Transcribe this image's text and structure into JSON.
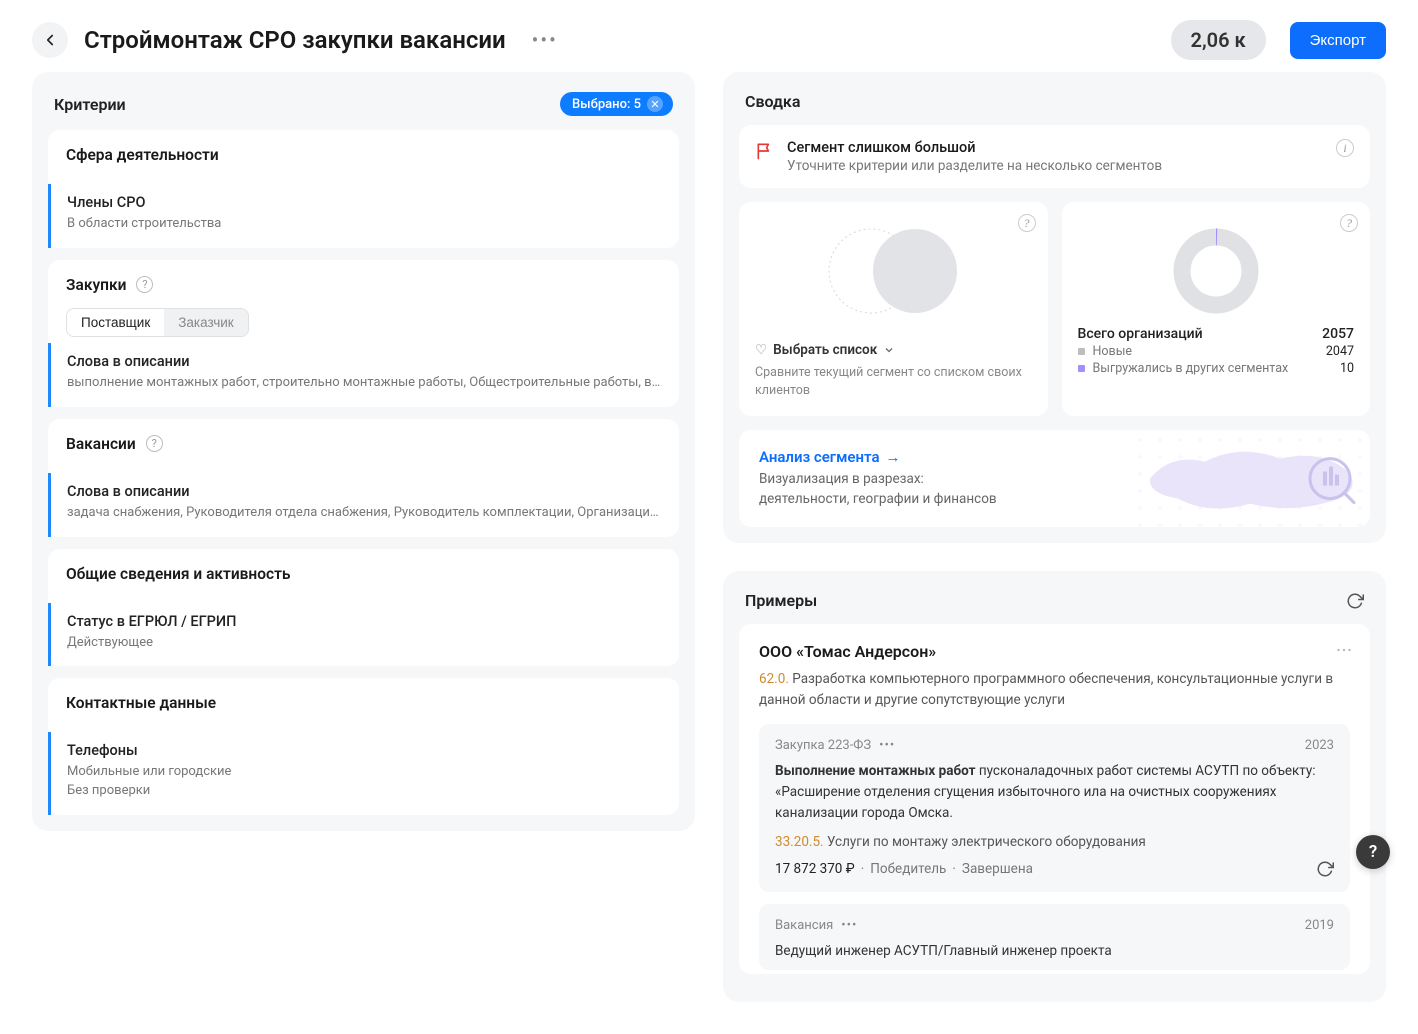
{
  "header": {
    "title": "Строймонтаж СРО закупки вакансии",
    "count": "2,06 к",
    "export": "Экспорт"
  },
  "criteria_panel": {
    "title": "Критерии",
    "selected_label": "Выбрано: 5",
    "groups": [
      {
        "title": "Сфера деятельности",
        "items": [
          {
            "label": "Члены СРО",
            "desc": "В области строительства"
          }
        ]
      },
      {
        "title": "Закупки",
        "has_help": true,
        "toggle": [
          "Поставщик",
          "Заказчик"
        ],
        "toggle_active": 0,
        "items": [
          {
            "label": "Слова в описании",
            "desc": "выполнение монтажных работ, строительно монтажные работы, Общестроительные работы, возведен…"
          }
        ]
      },
      {
        "title": "Вакансии",
        "has_help": true,
        "items": [
          {
            "label": "Слова в описании",
            "desc": "задача снабжения, Руководителя отдела снабжения, Руководитель комплектации, Организация работ…"
          }
        ]
      },
      {
        "title": "Общие сведения и активность",
        "items": [
          {
            "label": "Статус в ЕГРЮЛ / ЕГРИП",
            "desc": "Действующее"
          }
        ]
      },
      {
        "title": "Контактные данные",
        "items": [
          {
            "label": "Телефоны",
            "desc": "Мобильные или городские\nБез проверки"
          }
        ]
      }
    ]
  },
  "summary_panel": {
    "title": "Сводка",
    "alert": {
      "title": "Сегмент слишком большой",
      "sub": "Уточните критерии или разделите на несколько сегментов"
    },
    "venn_card": {
      "select_list": "Выбрать список",
      "compare": "Сравните текущий сегмент со списком своих клиентов"
    },
    "donut_card": {
      "total_label": "Всего организаций",
      "total_value": "2057",
      "lines": [
        {
          "label": "Новые",
          "value": "2047",
          "color": "#bdbdbd"
        },
        {
          "label": "Выгружались в других сегментах",
          "value": "10",
          "color": "#a58cff"
        }
      ]
    },
    "analysis": {
      "title": "Анализ сегмента",
      "sub": "Визуализация в разрезах:\nдеятельности, географии и финансов"
    }
  },
  "examples_panel": {
    "title": "Примеры",
    "card": {
      "title": "ООО «Томас Андерсон»",
      "cat_code": "62.0.",
      "cat_text": "Разработка компьютерного программного обеспечения, консультационные услуги в данной области и другие сопутствующие услуги",
      "purchase": {
        "tag": "Закупка 223-ФЗ",
        "year": "2023",
        "bold": "Выполнение монтажных работ",
        "rest": " пусконаладочных работ системы АСУТП по объекту: «Расширение отделения сгущения избыточного ила на очистных сооружениях канализации города Омска.",
        "cat_code": "33.20.5.",
        "cat_text": "Услуги по монтажу электрического оборудования",
        "price": "17 872 370 ₽",
        "status1": "Победитель",
        "status2": "Завершена"
      },
      "vacancy": {
        "tag": "Вакансия",
        "year": "2019",
        "title": "Ведущий инженер АСУТП/Главный инженер проекта"
      }
    }
  },
  "chart_data": {
    "type": "pie",
    "title": "Всего организаций",
    "total": 2057,
    "series": [
      {
        "name": "Новые",
        "value": 2047,
        "color": "#bdbdbd"
      },
      {
        "name": "Выгружались в других сегментах",
        "value": 10,
        "color": "#a58cff"
      }
    ]
  }
}
